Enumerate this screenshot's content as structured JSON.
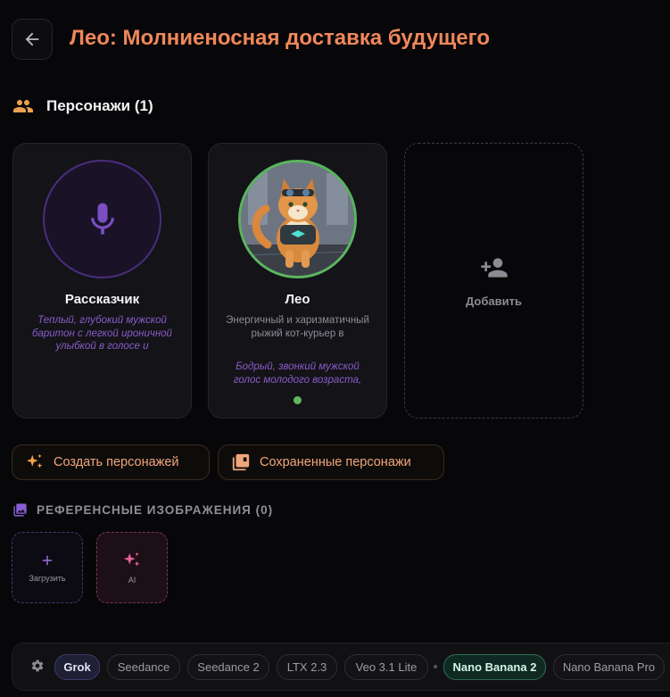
{
  "header": {
    "title": "Лео: Молниеносная доставка будущего"
  },
  "characters": {
    "heading": "Персонажи (1)",
    "cards": [
      {
        "name": "Рассказчик",
        "voice": "Теплый, глубокий мужской баритон с легкой ироничной улыбкой в голосе и"
      },
      {
        "name": "Лео",
        "description": "Энергичный и харизматичный рыжий кот-курьер в",
        "voice": "Бодрый, звонкий мужской голос молодого возраста,"
      }
    ],
    "add_label": "Добавить"
  },
  "actions": {
    "create_label": "Создать персонажей",
    "saved_label": "Сохраненные персонажи"
  },
  "references": {
    "heading": "РЕФЕРЕНСНЫЕ ИЗОБРАЖЕНИЯ (0)",
    "upload_label": "Загрузить",
    "ai_label": "AI"
  },
  "models": {
    "chips": [
      "Grok",
      "Seedance",
      "Seedance 2",
      "LTX 2.3",
      "Veo 3.1 Lite",
      "Nano Banana 2",
      "Nano Banana Pro"
    ],
    "selected": [
      "Grok",
      "Nano Banana 2"
    ]
  },
  "colors": {
    "title": "#f0875a",
    "accent_orange": "#f2a57a",
    "accent_purple": "#8a5cc8",
    "status_green": "#5fb85f"
  }
}
